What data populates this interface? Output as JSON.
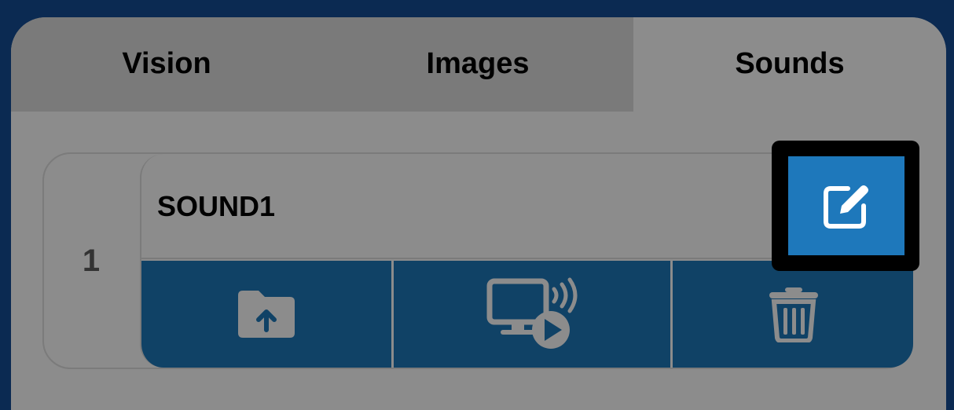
{
  "tabs": [
    {
      "label": "Vision",
      "active": false
    },
    {
      "label": "Images",
      "active": false
    },
    {
      "label": "Sounds",
      "active": true
    }
  ],
  "sounds": [
    {
      "index": "1",
      "name": "SOUND1",
      "actions": [
        "folder-upload-icon",
        "screen-play-icon",
        "trash-icon"
      ],
      "edit_icon": "edit-icon"
    }
  ],
  "colors": {
    "background": "#0b2a52",
    "panel": "#8c8c8c",
    "inactive_tab": "#7a7a7a",
    "action_bar": "#104266",
    "edit_button": "#1e78bb",
    "icon": "#8c8c8c"
  }
}
